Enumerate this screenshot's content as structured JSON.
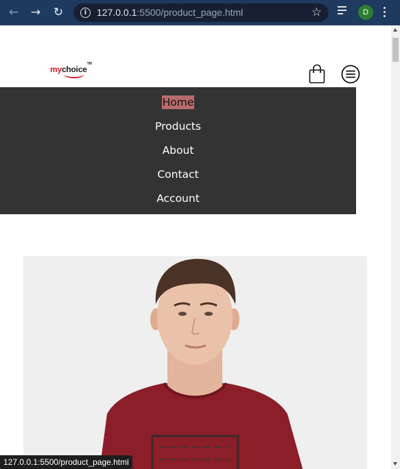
{
  "browser": {
    "url_host": "127.0.0.1",
    "url_rest": ":5500/product_page.html",
    "profile_initial": "D"
  },
  "site": {
    "logo_my": "my",
    "logo_choice": "choice",
    "logo_tm": "TM"
  },
  "menu": {
    "items": [
      {
        "label": "Home"
      },
      {
        "label": "Products"
      },
      {
        "label": "About"
      },
      {
        "label": "Contact"
      },
      {
        "label": "Account"
      }
    ]
  },
  "status_bar": {
    "text": "127.0.0.1:5500/product_page.html"
  },
  "colors": {
    "chrome": "#1f3a5f",
    "menu_bg": "#333333",
    "active_highlight": "#b96b6b",
    "brand_red": "#d71920",
    "tshirt": "#8b1e28"
  },
  "icons": {
    "back": "arrow-left-icon",
    "forward": "arrow-right-icon",
    "reload": "reload-icon",
    "info": "info-icon",
    "bookmark": "star-icon",
    "queue": "media-queue-icon",
    "more": "kebab-menu-icon",
    "cart": "shopping-bag-icon",
    "menu": "hamburger-circle-icon"
  }
}
